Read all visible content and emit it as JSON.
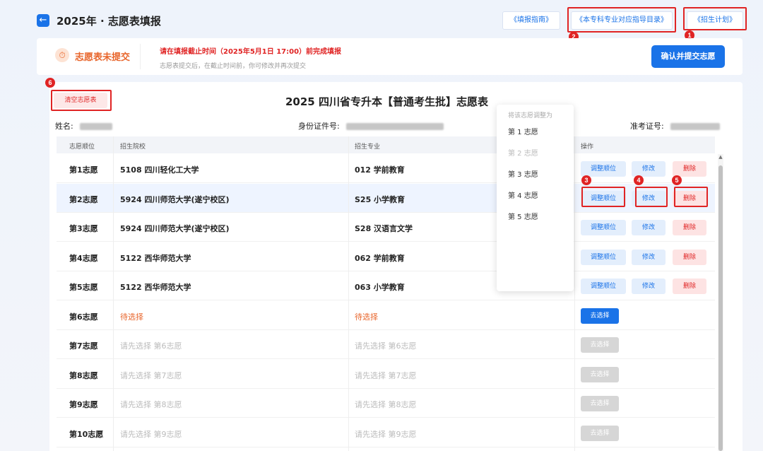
{
  "header": {
    "title": "2025年 · 志愿表填报",
    "links": [
      "《填报指南》",
      "《本专科专业对应指导目录》",
      "《招生计划》"
    ]
  },
  "status": {
    "title": "志愿表未提交",
    "deadline": "请在填报截止时间（2025年5月1日 17:00）前完成填报",
    "hint": "志愿表提交后，在截止时间前，你可修改并再次提交",
    "submit_label": "确认并提交志愿"
  },
  "form": {
    "clear_label": "清空志愿表",
    "title": "2025 四川省专升本【普通考生批】志愿表",
    "name_label": "姓名:",
    "id_label": "身份证件号:",
    "ticket_label": "准考证号:"
  },
  "table": {
    "headers": [
      "志愿顺位",
      "招生院校",
      "招生专业",
      "操作"
    ],
    "rows": [
      {
        "rank": "第1志愿",
        "school": "5108 四川轻化工大学",
        "major": "012 学前教育",
        "state": "filled"
      },
      {
        "rank": "第2志愿",
        "school": "5924 四川师范大学(遂宁校区)",
        "major": "S25 小学教育",
        "state": "filled"
      },
      {
        "rank": "第3志愿",
        "school": "5924 四川师范大学(遂宁校区)",
        "major": "S28 汉语言文学",
        "state": "filled"
      },
      {
        "rank": "第4志愿",
        "school": "5122 西华师范大学",
        "major": "062 学前教育",
        "state": "filled"
      },
      {
        "rank": "第5志愿",
        "school": "5122 西华师范大学",
        "major": "063 小学教育",
        "state": "filled"
      },
      {
        "rank": "第6志愿",
        "school": "待选择",
        "major": "待选择",
        "state": "pending"
      },
      {
        "rank": "第7志愿",
        "school": "请先选择 第6志愿",
        "major": "请先选择 第6志愿",
        "state": "disabled"
      },
      {
        "rank": "第8志愿",
        "school": "请先选择 第7志愿",
        "major": "请先选择 第7志愿",
        "state": "disabled"
      },
      {
        "rank": "第9志愿",
        "school": "请先选择 第8志愿",
        "major": "请先选择 第8志愿",
        "state": "disabled"
      },
      {
        "rank": "第10志愿",
        "school": "请先选择 第9志愿",
        "major": "请先选择 第9志愿",
        "state": "disabled"
      }
    ],
    "ops": {
      "adjust": "调整顺位",
      "edit": "修改",
      "delete": "删除",
      "choose": "去选择"
    }
  },
  "dropdown": {
    "title": "将该志愿调整为",
    "items": [
      "第 1 志愿",
      "第 2 志愿",
      "第 3 志愿",
      "第 4 志愿",
      "第 5 志愿"
    ]
  },
  "callouts": [
    "1",
    "2",
    "3",
    "4",
    "5",
    "6"
  ]
}
